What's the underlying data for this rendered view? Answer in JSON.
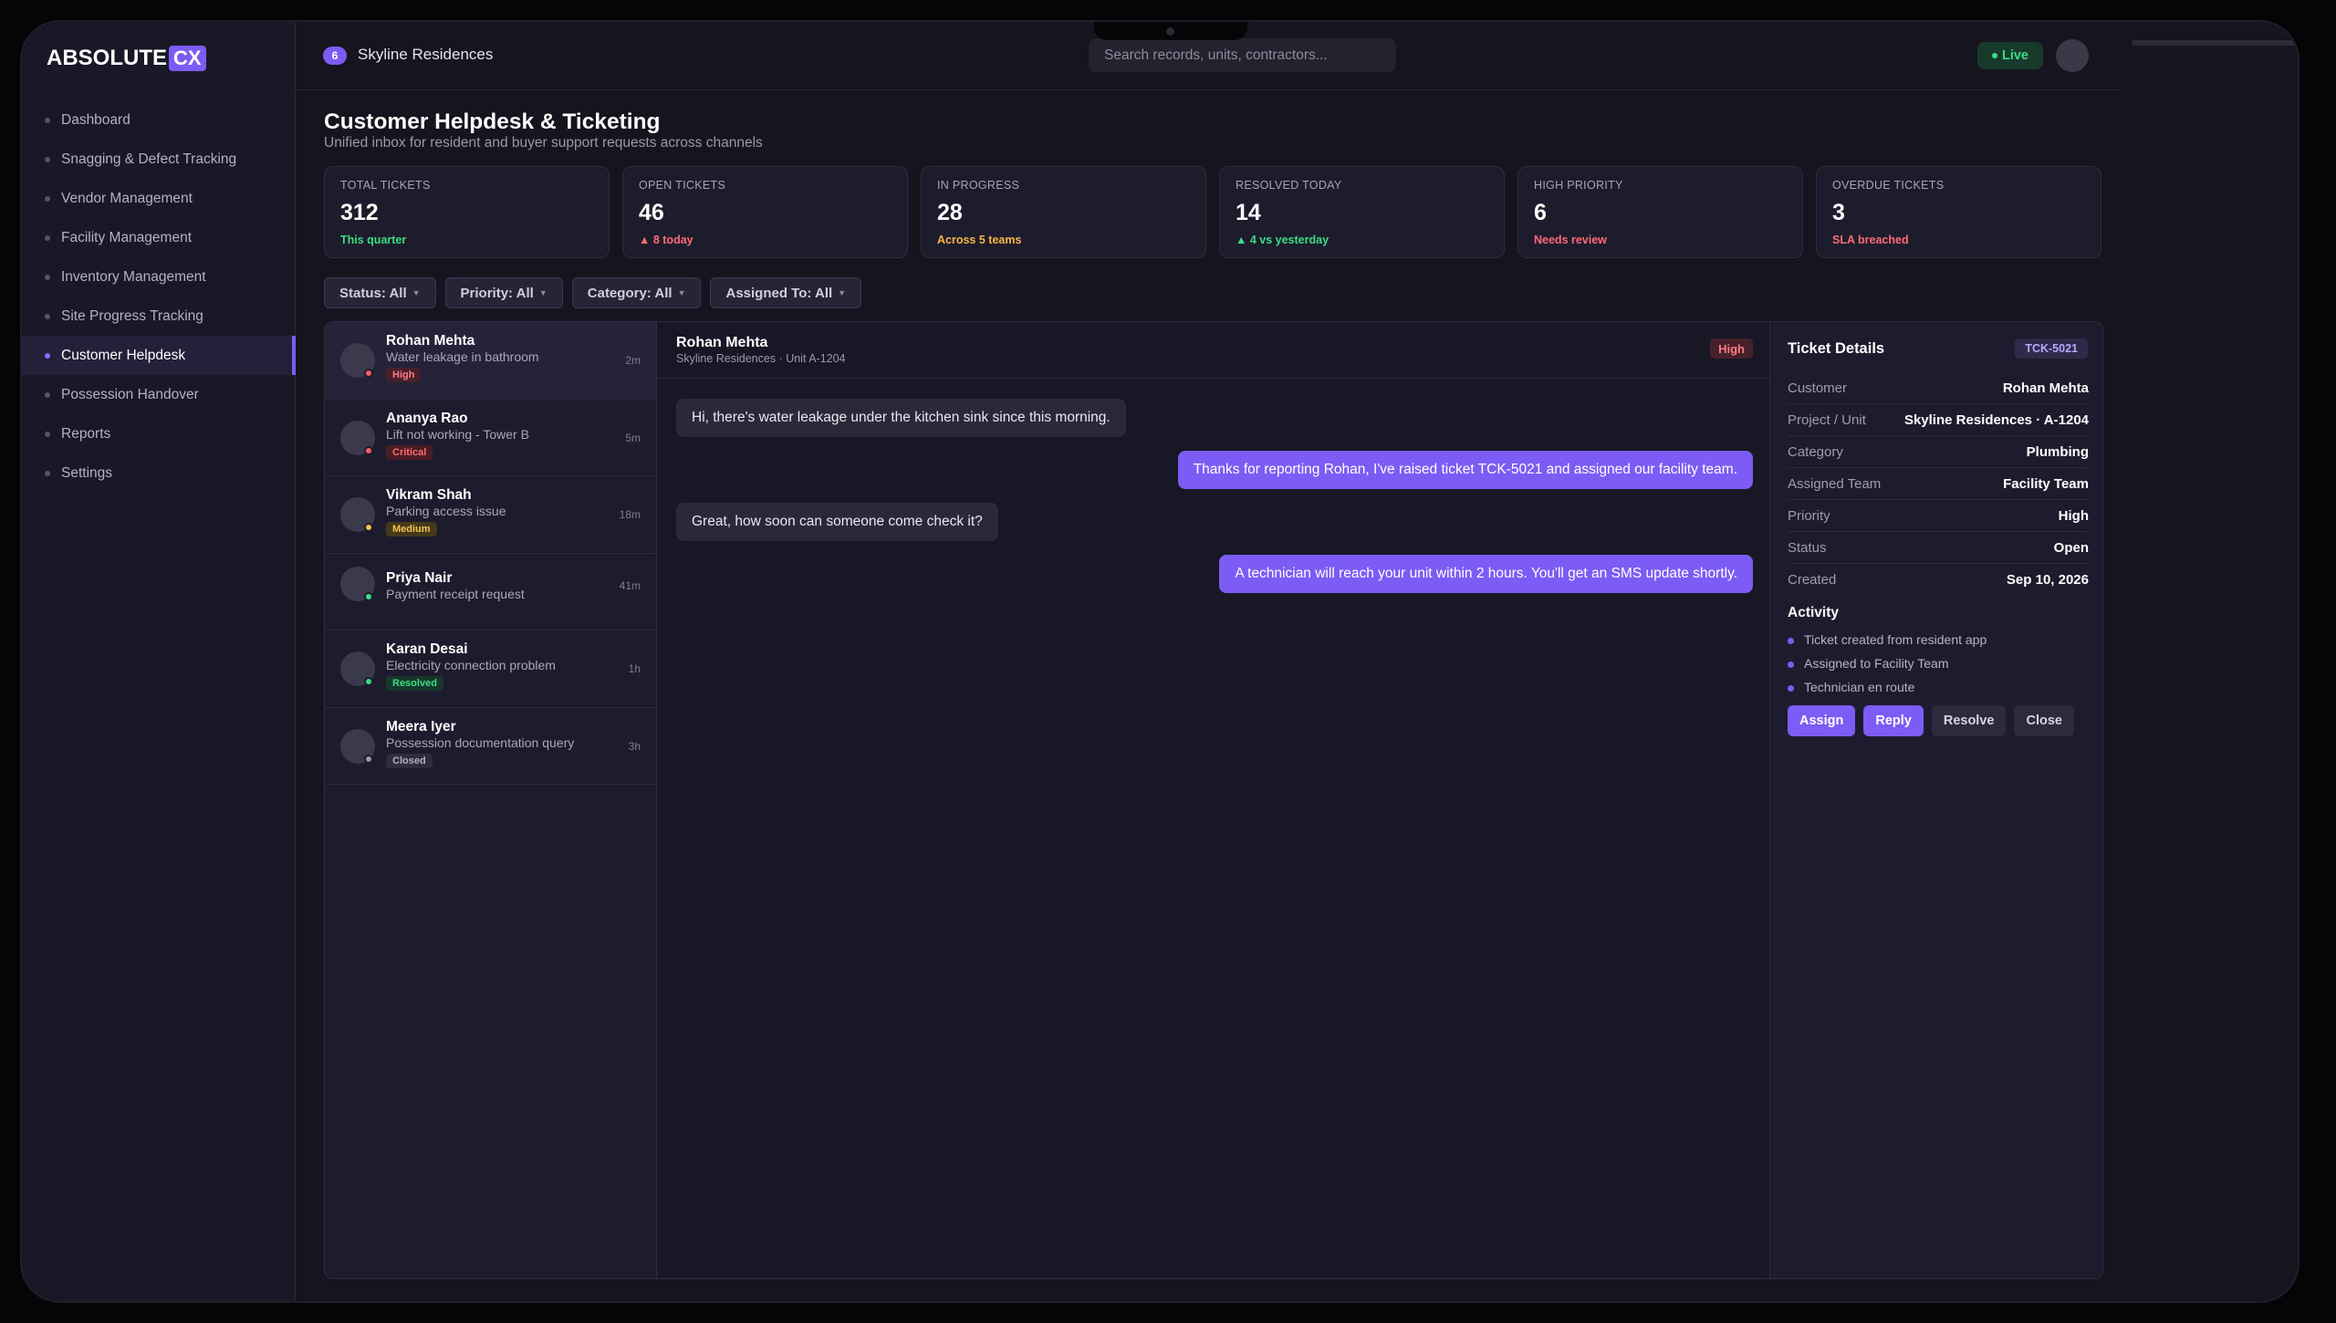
{
  "brand": {
    "name": "ABSOLUTE",
    "suffix": "CX"
  },
  "sidebar": {
    "items": [
      {
        "label": "Dashboard"
      },
      {
        "label": "Snagging & Defect Tracking"
      },
      {
        "label": "Vendor Management"
      },
      {
        "label": "Facility Management"
      },
      {
        "label": "Inventory Management"
      },
      {
        "label": "Site Progress Tracking"
      },
      {
        "label": "Customer Helpdesk",
        "active": true
      },
      {
        "label": "Possession Handover"
      },
      {
        "label": "Reports"
      },
      {
        "label": "Settings"
      }
    ]
  },
  "topbar": {
    "project_count": "6",
    "project_name": "Skyline Residences",
    "search_placeholder": "Search records, units, contractors...",
    "live_label": "Live"
  },
  "page": {
    "title": "Customer Helpdesk & Ticketing",
    "subtitle": "Unified inbox for resident and buyer support requests across channels"
  },
  "stats": [
    {
      "label": "TOTAL TICKETS",
      "value": "312",
      "note": "This quarter",
      "note_color": "#3ddc84"
    },
    {
      "label": "OPEN TICKETS",
      "value": "46",
      "note": "▲ 8 today",
      "note_color": "#ff6b74"
    },
    {
      "label": "IN PROGRESS",
      "value": "28",
      "note": "Across 5 teams",
      "note_color": "#f5b547"
    },
    {
      "label": "RESOLVED TODAY",
      "value": "14",
      "note": "▲ 4 vs yesterday",
      "note_color": "#3ddc84"
    },
    {
      "label": "HIGH PRIORITY",
      "value": "6",
      "note": "Needs review",
      "note_color": "#ff6b74"
    },
    {
      "label": "OVERDUE TICKETS",
      "value": "3",
      "note": "SLA breached",
      "note_color": "#ff6b74"
    }
  ],
  "filters": [
    {
      "label": "Status: All"
    },
    {
      "label": "Priority: All"
    },
    {
      "label": "Category: All"
    },
    {
      "label": "Assigned To: All"
    }
  ],
  "tickets": [
    {
      "name": "Rohan Mehta",
      "subject": "Water leakage in bathroom",
      "tag": "High",
      "tag_bg": "#47202a",
      "tag_fg": "#ff7b85",
      "time": "2m",
      "status_color": "#ff5c66",
      "active": true
    },
    {
      "name": "Ananya Rao",
      "subject": "Lift not working - Tower B",
      "tag": "Critical",
      "tag_bg": "#4a1c24",
      "tag_fg": "#ff6b74",
      "time": "5m",
      "status_color": "#ff5c66"
    },
    {
      "name": "Vikram Shah",
      "subject": "Parking access issue",
      "tag": "Medium",
      "tag_bg": "#45391a",
      "tag_fg": "#f5c453",
      "time": "18m",
      "status_color": "#f5c453"
    },
    {
      "name": "Priya Nair",
      "subject": "Payment receipt request",
      "tag": "",
      "tag_bg": "",
      "tag_fg": "",
      "time": "41m",
      "status_color": "#3ddc84"
    },
    {
      "name": "Karan Desai",
      "subject": "Electricity connection problem",
      "tag": "Resolved",
      "tag_bg": "#17382b",
      "tag_fg": "#3ddc84",
      "time": "1h",
      "status_color": "#3ddc84"
    },
    {
      "name": "Meera Iyer",
      "subject": "Possession documentation query",
      "tag": "Closed",
      "tag_bg": "#2e2d3d",
      "tag_fg": "#b0afc0",
      "time": "3h",
      "status_color": "#9a99ab"
    }
  ],
  "chat": {
    "name": "Rohan Mehta",
    "sub": "Skyline Residences · Unit A-1204",
    "priority": "High",
    "messages": [
      {
        "dir": "in",
        "text": "Hi, there's water leakage under the kitchen sink since this morning."
      },
      {
        "dir": "out",
        "text": "Thanks for reporting Rohan, I've raised ticket TCK-5021 and assigned our facility team."
      },
      {
        "dir": "in",
        "text": "Great, how soon can someone come check it?"
      },
      {
        "dir": "out",
        "text": "A technician will reach your unit within 2 hours. You'll get an SMS update shortly."
      }
    ]
  },
  "details": {
    "title": "Ticket Details",
    "id": "TCK-5021",
    "rows": [
      {
        "k": "Customer",
        "v": "Rohan Mehta"
      },
      {
        "k": "Project / Unit",
        "v": "Skyline Residences · A-1204"
      },
      {
        "k": "Category",
        "v": "Plumbing"
      },
      {
        "k": "Assigned Team",
        "v": "Facility Team"
      },
      {
        "k": "Priority",
        "v": "High"
      },
      {
        "k": "Status",
        "v": "Open"
      },
      {
        "k": "Created",
        "v": "Sep 10, 2026"
      }
    ],
    "activity_title": "Activity",
    "activity": [
      "Ticket created from resident app",
      "Assigned to Facility Team",
      "Technician en route"
    ],
    "buttons": [
      {
        "label": "Assign",
        "style": "primary"
      },
      {
        "label": "Reply",
        "style": "primary"
      },
      {
        "label": "Resolve",
        "style": "secondary"
      },
      {
        "label": "Close",
        "style": "secondary"
      }
    ]
  }
}
